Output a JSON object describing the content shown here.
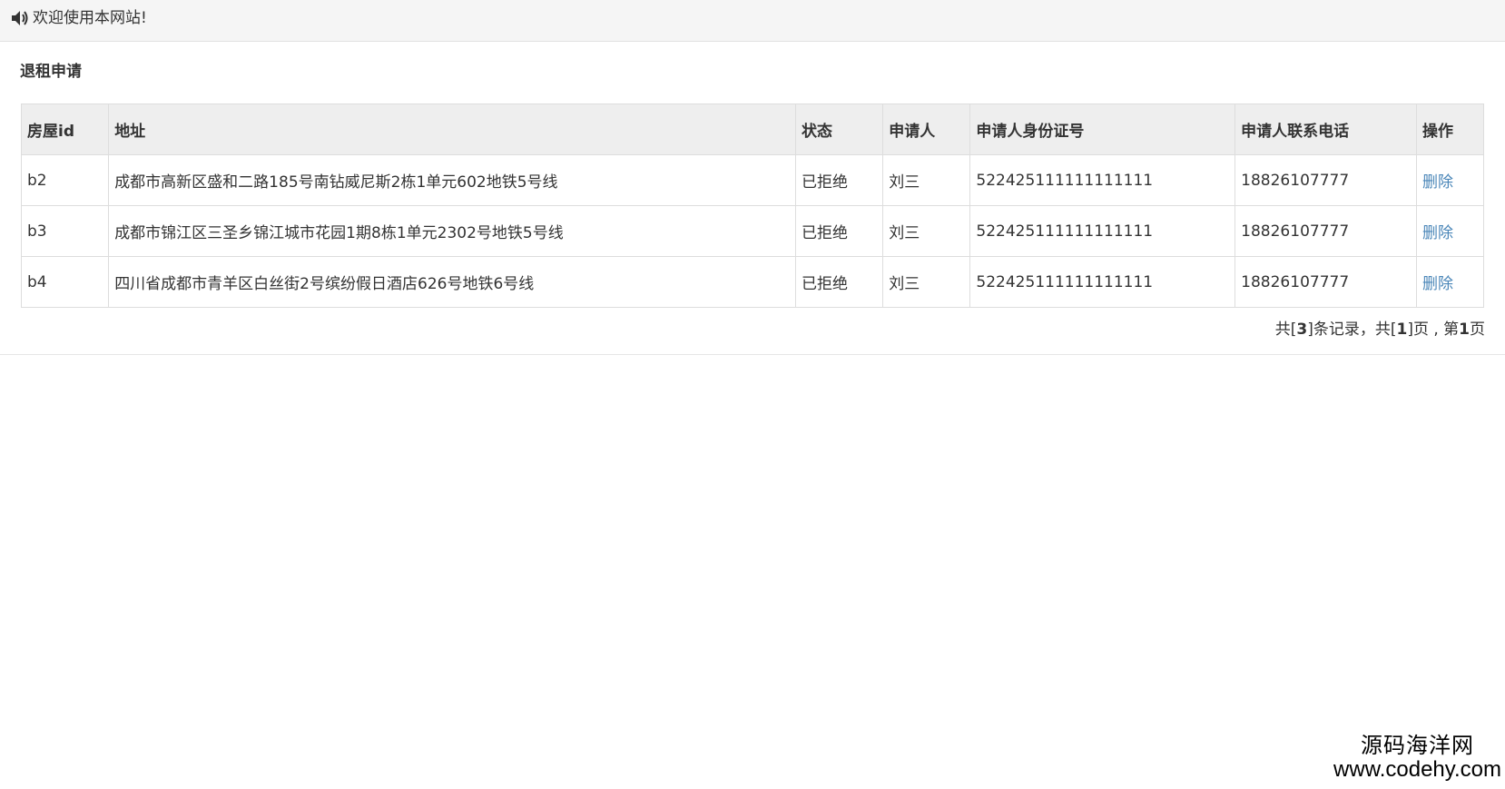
{
  "topbar": {
    "icon": "speaker-icon",
    "welcome_text": "欢迎使用本网站!"
  },
  "panel": {
    "title": "退租申请"
  },
  "table": {
    "headers": {
      "house_id": "房屋id",
      "address": "地址",
      "status": "状态",
      "applicant": "申请人",
      "id_number": "申请人身份证号",
      "phone": "申请人联系电话",
      "action": "操作"
    },
    "rows": [
      {
        "house_id": "b2",
        "address": "成都市高新区盛和二路185号南钻威尼斯2栋1单元602地铁5号线",
        "status": "已拒绝",
        "applicant": "刘三",
        "id_number": "522425111111111111",
        "phone": "18826107777",
        "action": "删除"
      },
      {
        "house_id": "b3",
        "address": "成都市锦江区三圣乡锦江城市花园1期8栋1单元2302号地铁5号线",
        "status": "已拒绝",
        "applicant": "刘三",
        "id_number": "522425111111111111",
        "phone": "18826107777",
        "action": "删除"
      },
      {
        "house_id": "b4",
        "address": "四川省成都市青羊区白丝街2号缤纷假日酒店626号地铁6号线",
        "status": "已拒绝",
        "applicant": "刘三",
        "id_number": "522425111111111111",
        "phone": "18826107777",
        "action": "删除"
      }
    ]
  },
  "pager": {
    "prefix": "共[",
    "total_records": "3",
    "mid1": "]条记录，共[",
    "total_pages": "1",
    "mid2": "]页 , 第",
    "current_page": "1",
    "suffix": "页"
  },
  "watermark": {
    "name": "源码海洋网",
    "url": "www.codehy.com"
  },
  "colors": {
    "topbar_bg": "#f5f5f5",
    "header_bg": "#eeeeee",
    "link": "#4a86b8",
    "border": "#dddddd"
  }
}
